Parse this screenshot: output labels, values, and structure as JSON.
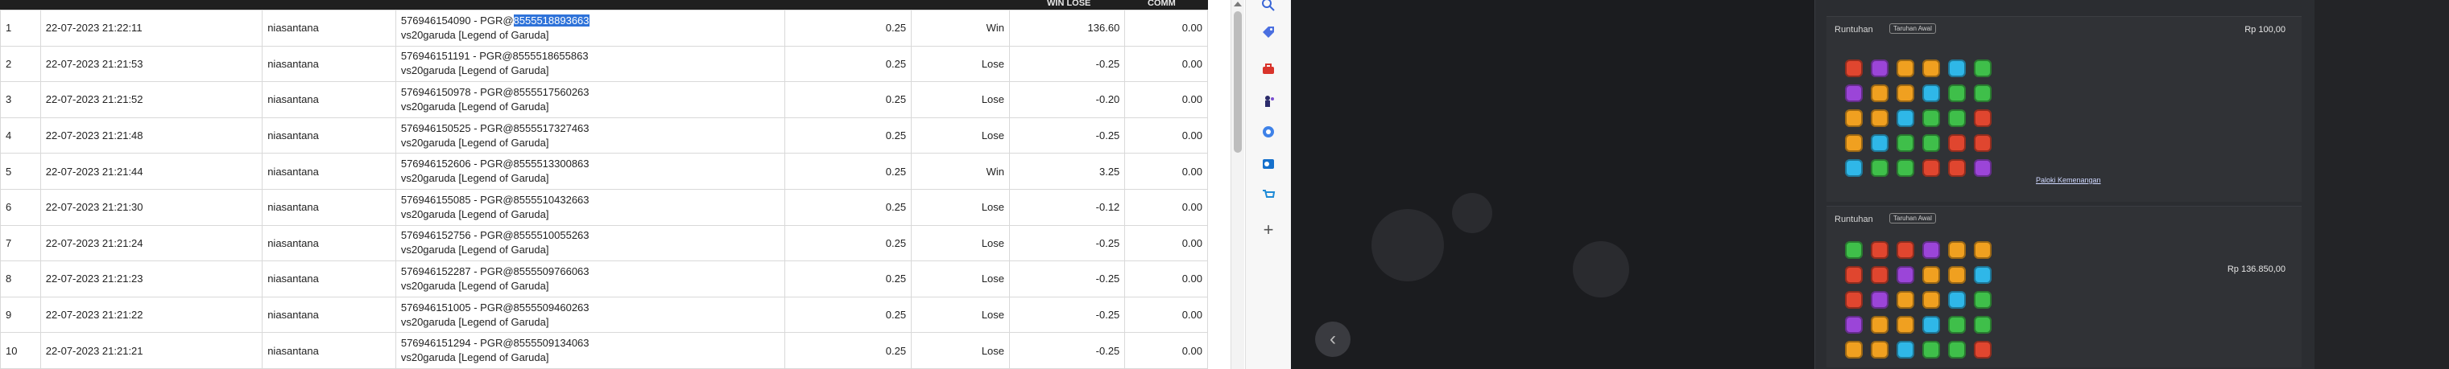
{
  "table": {
    "headers": [
      "WIN LOSE",
      "COMM"
    ],
    "rows": [
      {
        "no": "1",
        "date": "22-07-2023 21:22:11",
        "user": "niasantana",
        "desc1_pre": "576946154090 - PGR@",
        "desc1_sel": "8555518893663",
        "desc2": "vs20garuda [Legend of Garuda]",
        "bet": "0.25",
        "result": "Win",
        "winlose": "136.60",
        "comm": "0.00"
      },
      {
        "no": "2",
        "date": "22-07-2023 21:21:53",
        "user": "niasantana",
        "desc1_pre": "576946151191 - PGR@8555518655863",
        "desc1_sel": "",
        "desc2": "vs20garuda [Legend of Garuda]",
        "bet": "0.25",
        "result": "Lose",
        "winlose": "-0.25",
        "comm": "0.00"
      },
      {
        "no": "3",
        "date": "22-07-2023 21:21:52",
        "user": "niasantana",
        "desc1_pre": "576946150978 - PGR@8555517560263",
        "desc1_sel": "",
        "desc2": "vs20garuda [Legend of Garuda]",
        "bet": "0.25",
        "result": "Lose",
        "winlose": "-0.20",
        "comm": "0.00"
      },
      {
        "no": "4",
        "date": "22-07-2023 21:21:48",
        "user": "niasantana",
        "desc1_pre": "576946150525 - PGR@8555517327463",
        "desc1_sel": "",
        "desc2": "vs20garuda [Legend of Garuda]",
        "bet": "0.25",
        "result": "Lose",
        "winlose": "-0.25",
        "comm": "0.00"
      },
      {
        "no": "5",
        "date": "22-07-2023 21:21:44",
        "user": "niasantana",
        "desc1_pre": "576946152606 - PGR@8555513300863",
        "desc1_sel": "",
        "desc2": "vs20garuda [Legend of Garuda]",
        "bet": "0.25",
        "result": "Win",
        "winlose": "3.25",
        "comm": "0.00"
      },
      {
        "no": "6",
        "date": "22-07-2023 21:21:30",
        "user": "niasantana",
        "desc1_pre": "576946155085 - PGR@8555510432663",
        "desc1_sel": "",
        "desc2": "vs20garuda [Legend of Garuda]",
        "bet": "0.25",
        "result": "Lose",
        "winlose": "-0.12",
        "comm": "0.00"
      },
      {
        "no": "7",
        "date": "22-07-2023 21:21:24",
        "user": "niasantana",
        "desc1_pre": "576946152756 - PGR@8555510055263",
        "desc1_sel": "",
        "desc2": "vs20garuda [Legend of Garuda]",
        "bet": "0.25",
        "result": "Lose",
        "winlose": "-0.25",
        "comm": "0.00"
      },
      {
        "no": "8",
        "date": "22-07-2023 21:21:23",
        "user": "niasantana",
        "desc1_pre": "576946152287 - PGR@8555509766063",
        "desc1_sel": "",
        "desc2": "vs20garuda [Legend of Garuda]",
        "bet": "0.25",
        "result": "Lose",
        "winlose": "-0.25",
        "comm": "0.00"
      },
      {
        "no": "9",
        "date": "22-07-2023 21:21:22",
        "user": "niasantana",
        "desc1_pre": "576946151005 - PGR@8555509460263",
        "desc1_sel": "",
        "desc2": "vs20garuda [Legend of Garuda]",
        "bet": "0.25",
        "result": "Lose",
        "winlose": "-0.25",
        "comm": "0.00"
      },
      {
        "no": "10",
        "date": "22-07-2023 21:21:21",
        "user": "niasantana",
        "desc1_pre": "576946151294 - PGR@8555509134063",
        "desc1_sel": "",
        "desc2": "vs20garuda [Legend of Garuda]",
        "bet": "0.25",
        "result": "Lose",
        "winlose": "-0.25",
        "comm": "0.00"
      }
    ]
  },
  "sidebar": {
    "icons": [
      "search-icon",
      "tag-icon",
      "toolbox-icon",
      "chess-icon",
      "office-icon",
      "outlook-icon",
      "shopping-icon",
      "add-icon"
    ]
  },
  "game": {
    "card1": {
      "label": "Runtuhan",
      "pill": "Taruhan Awal",
      "amount": "Rp 100,00",
      "link": "Paloki Kemenangan"
    },
    "card2": {
      "label": "Runtuhan",
      "pill": "Taruhan Awal",
      "amount": "Rp 136.850,00"
    }
  },
  "colors": {
    "win": "#1f9d3a",
    "lose": "#e02b2b",
    "selection": "#2f73d9",
    "dark": "#232427"
  }
}
